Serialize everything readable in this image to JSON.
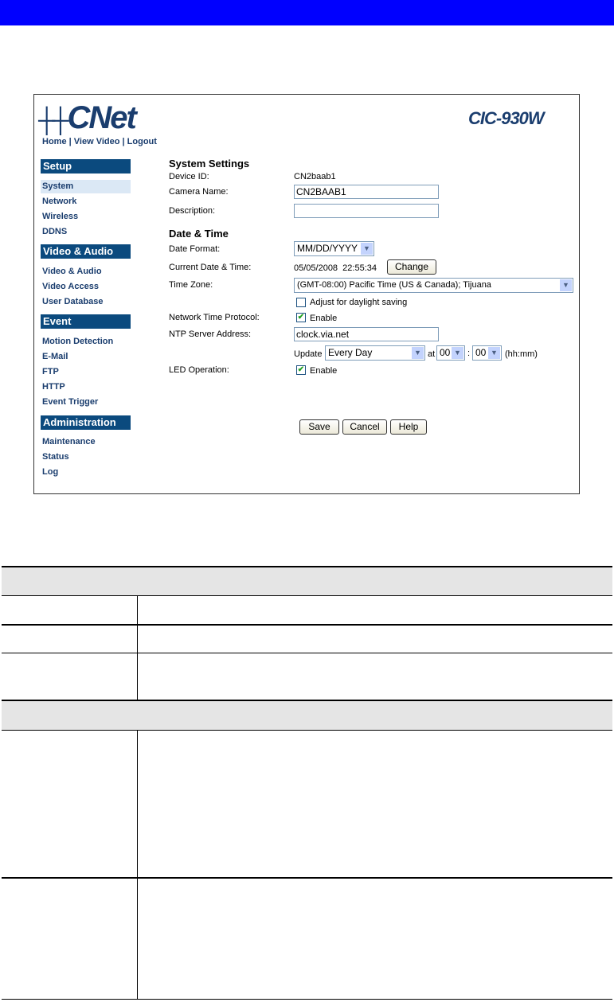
{
  "app": {
    "logo_text": "CNet",
    "model": "CIC-930W"
  },
  "top_links": [
    "Home",
    "View Video",
    "Logout"
  ],
  "sidebar": {
    "sections": [
      {
        "title": "Setup",
        "items": [
          "System",
          "Network",
          "Wireless",
          "DDNS"
        ]
      },
      {
        "title": "Video & Audio",
        "items": [
          "Video & Audio",
          "Video Access",
          "User Database"
        ]
      },
      {
        "title": "Event",
        "items": [
          "Motion Detection",
          "E-Mail",
          "FTP",
          "HTTP",
          "Event Trigger"
        ]
      },
      {
        "title": "Administration",
        "items": [
          "Maintenance",
          "Status",
          "Log"
        ]
      }
    ],
    "active": "System"
  },
  "form": {
    "system_settings_title": "System Settings",
    "device_id_label": "Device ID:",
    "device_id": "CN2baab1",
    "camera_name_label": "Camera Name:",
    "camera_name": "CN2BAAB1",
    "description_label": "Description:",
    "description": "",
    "date_time_title": "Date & Time",
    "date_format_label": "Date Format:",
    "date_format": "MM/DD/YYYY",
    "current_dt_label": "Current Date & Time:",
    "current_dt": "05/05/2008  22:55:34",
    "change_label": "Change",
    "time_zone_label": "Time Zone:",
    "time_zone": "(GMT-08:00) Pacific Time (US & Canada); Tijuana",
    "daylight_label": "Adjust for daylight saving",
    "daylight_checked": false,
    "ntp_label": "Network Time Protocol:",
    "ntp_enable_label": "Enable",
    "ntp_checked": true,
    "ntp_server_label": "NTP Server Address:",
    "ntp_server": "clock.via.net",
    "update_label": "Update",
    "update_freq": "Every Day",
    "at_label": "at",
    "hour": "00",
    "colon": ":",
    "minute": "00",
    "hhmm": "(hh:mm)",
    "led_label": "LED Operation:",
    "led_enable_label": "Enable",
    "led_checked": true,
    "save": "Save",
    "cancel": "Cancel",
    "help": "Help"
  },
  "colors": {
    "top_bar": "#0000ff",
    "nav_header": "#0b4a7e",
    "nav_text": "#1a3d6e",
    "table_header": "#e5e5e5"
  }
}
